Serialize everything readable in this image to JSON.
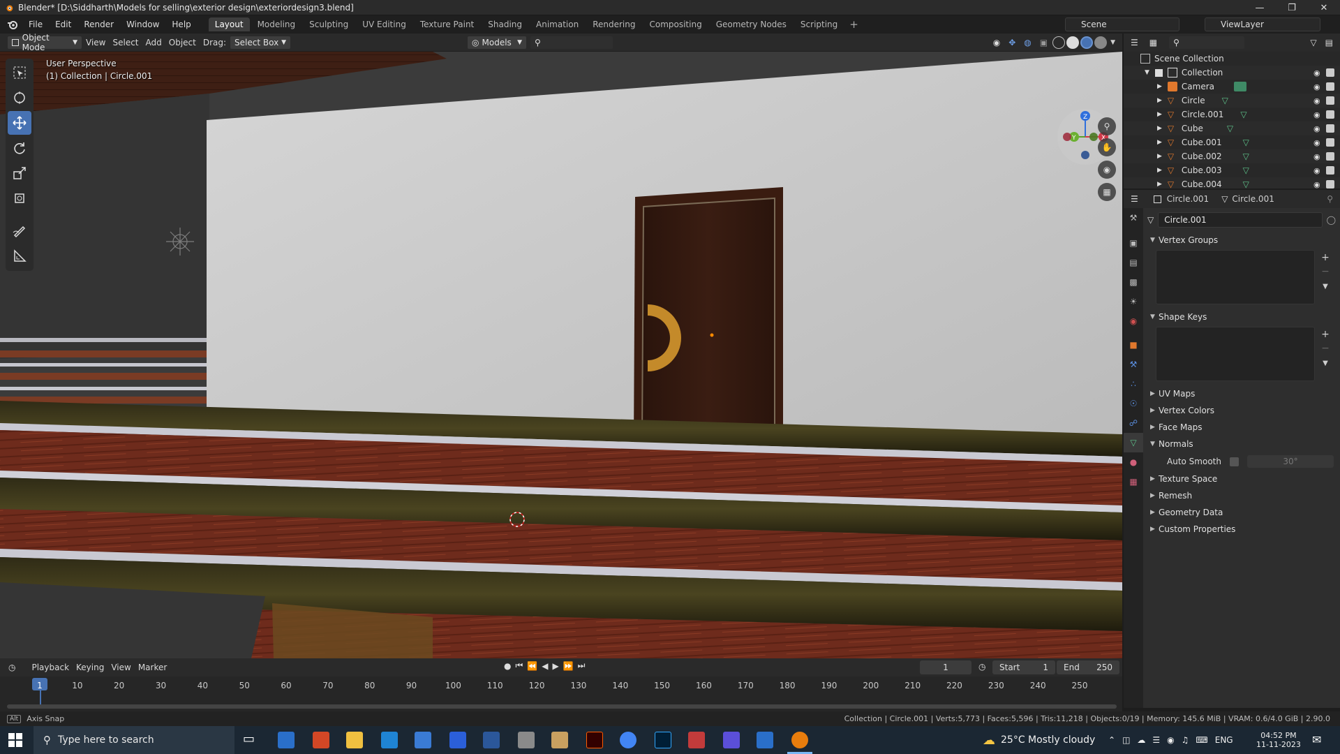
{
  "window": {
    "title": "Blender* [D:\\Siddharth\\Models for selling\\exterior design\\exteriordesign3.blend]"
  },
  "menu": {
    "items": [
      "File",
      "Edit",
      "Render",
      "Window",
      "Help"
    ]
  },
  "workspaces": [
    "Layout",
    "Modeling",
    "Sculpting",
    "UV Editing",
    "Texture Paint",
    "Shading",
    "Animation",
    "Rendering",
    "Compositing",
    "Geometry Nodes",
    "Scripting"
  ],
  "scene": {
    "name": "Scene",
    "view_layer": "ViewLayer"
  },
  "viewport_header": {
    "mode": "Object Mode",
    "menus": [
      "View",
      "Select",
      "Add",
      "Object"
    ],
    "drag_label": "Drag:",
    "drag_value": "Select Box",
    "models_label": "Models"
  },
  "viewport": {
    "perspective": "User Perspective",
    "collection_info": "(1) Collection | Circle.001",
    "gizmo_axes": [
      "X",
      "Y",
      "Z"
    ]
  },
  "outliner": {
    "root": "Scene Collection",
    "collection": "Collection",
    "objects": [
      {
        "name": "Camera",
        "icon": "camera-icon"
      },
      {
        "name": "Circle",
        "icon": "mesh-icon"
      },
      {
        "name": "Circle.001",
        "icon": "mesh-icon",
        "selected": true
      },
      {
        "name": "Cube",
        "icon": "mesh-icon"
      },
      {
        "name": "Cube.001",
        "icon": "mesh-icon"
      },
      {
        "name": "Cube.002",
        "icon": "mesh-icon"
      },
      {
        "name": "Cube.003",
        "icon": "mesh-icon"
      },
      {
        "name": "Cube.004",
        "icon": "mesh-icon"
      }
    ]
  },
  "properties": {
    "object_name": "Circle.001",
    "data_name": "Circle.001",
    "mesh_name": "Circle.001",
    "panels": {
      "vertex_groups": "Vertex Groups",
      "shape_keys": "Shape Keys",
      "uv_maps": "UV Maps",
      "vertex_colors": "Vertex Colors",
      "face_maps": "Face Maps",
      "normals": "Normals",
      "texture_space": "Texture Space",
      "remesh": "Remesh",
      "geometry_data": "Geometry Data",
      "custom_properties": "Custom Properties"
    },
    "auto_smooth_label": "Auto Smooth",
    "auto_smooth_angle": "30°"
  },
  "timeline": {
    "menus": [
      "Playback",
      "Keying",
      "View",
      "Marker"
    ],
    "current_frame": "1",
    "start_label": "Start",
    "start": "1",
    "end_label": "End",
    "end": "250",
    "ticks": [
      "1",
      "10",
      "20",
      "30",
      "40",
      "50",
      "60",
      "70",
      "80",
      "90",
      "100",
      "110",
      "120",
      "130",
      "140",
      "150",
      "160",
      "170",
      "180",
      "190",
      "200",
      "210",
      "220",
      "230",
      "240",
      "250"
    ]
  },
  "statusbar": {
    "left": "Axis Snap",
    "right": "Collection | Circle.001 | Verts:5,773 | Faces:5,596 | Tris:11,218 | Objects:0/19 | Memory: 145.6 MiB | VRAM: 0.6/4.0 GiB | 2.90.0"
  },
  "taskbar": {
    "search_placeholder": "Type here to search",
    "weather": "25°C  Mostly cloudy",
    "lang": "ENG",
    "time": "04:52 PM",
    "date": "11-11-2023"
  },
  "colors": {
    "accent": "#4772b3",
    "selected_row": "#334d80",
    "panel": "#2e2e2e"
  }
}
